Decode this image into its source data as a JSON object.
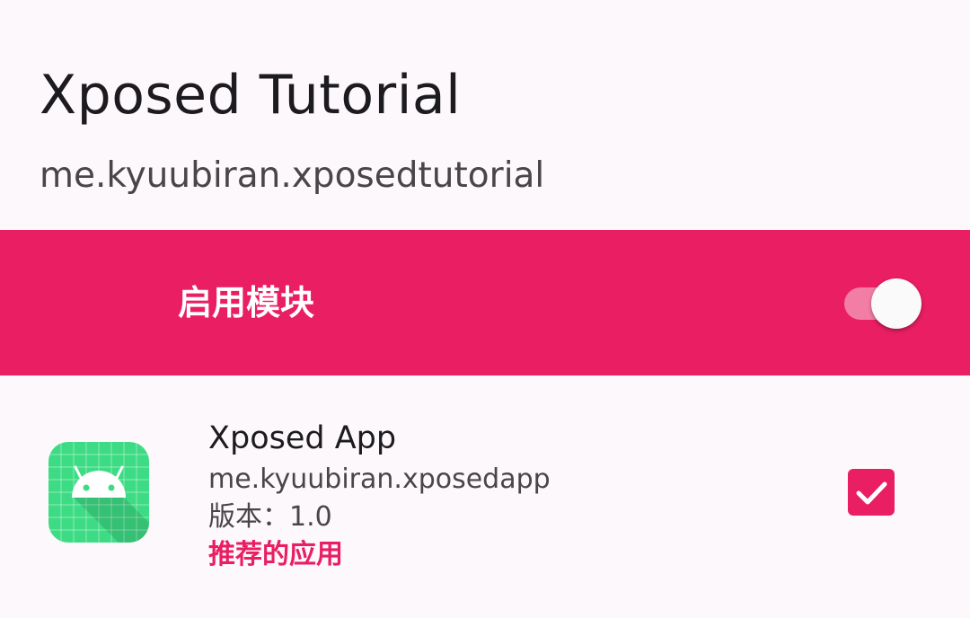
{
  "header": {
    "title": "Xposed Tutorial",
    "package": "me.kyuubiran.xposedtutorial"
  },
  "enable": {
    "label": "启用模块",
    "state": "on"
  },
  "app": {
    "name": "Xposed App",
    "package": "me.kyuubiran.xposedapp",
    "version": "版本：1.0",
    "recommend": "推荐的应用",
    "checked": true,
    "icon": "android-app-icon"
  },
  "colors": {
    "accent": "#e91e63",
    "switch_track": "#f27ea5",
    "background": "#fdf8fb",
    "icon_bg": "#3ddc84"
  }
}
